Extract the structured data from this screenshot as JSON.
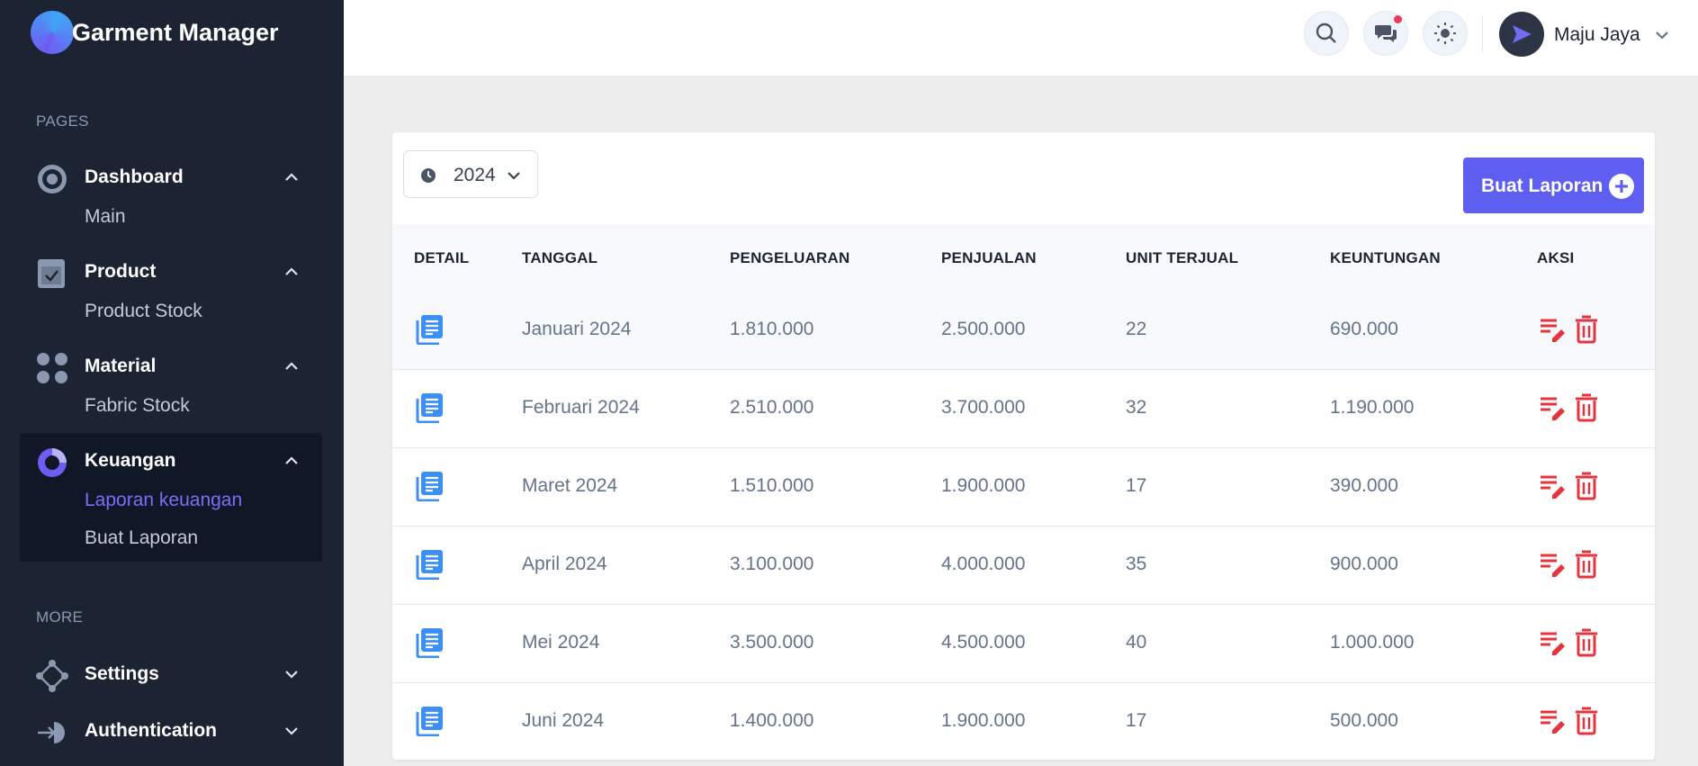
{
  "app": {
    "name": "Garment Manager"
  },
  "sidebar": {
    "group_pages": "PAGES",
    "group_more": "MORE",
    "dashboard": {
      "label": "Dashboard",
      "sub": [
        "Main"
      ]
    },
    "product": {
      "label": "Product",
      "sub": [
        "Product Stock"
      ]
    },
    "material": {
      "label": "Material",
      "sub": [
        "Fabric Stock"
      ]
    },
    "keuangan": {
      "label": "Keuangan",
      "sub": [
        "Laporan keuangan",
        "Buat Laporan"
      ],
      "active_sub": "Laporan keuangan"
    },
    "settings": {
      "label": "Settings"
    },
    "authentication": {
      "label": "Authentication"
    }
  },
  "header": {
    "user_name": "Maju Jaya",
    "icons": [
      "search-icon",
      "chat-icon",
      "sun-icon"
    ]
  },
  "toolbar": {
    "year": "2024",
    "create_label": "Buat Laporan"
  },
  "table": {
    "columns": [
      "DETAIL",
      "TANGGAL",
      "PENGELUARAN",
      "PENJUALAN",
      "UNIT TERJUAL",
      "KEUNTUNGAN",
      "AKSI"
    ],
    "rows": [
      {
        "tanggal": "Januari 2024",
        "pengeluaran": "1.810.000",
        "penjualan": "2.500.000",
        "unit": "22",
        "keuntungan": "690.000"
      },
      {
        "tanggal": "Februari 2024",
        "pengeluaran": "2.510.000",
        "penjualan": "3.700.000",
        "unit": "32",
        "keuntungan": "1.190.000"
      },
      {
        "tanggal": "Maret 2024",
        "pengeluaran": "1.510.000",
        "penjualan": "1.900.000",
        "unit": "17",
        "keuntungan": "390.000"
      },
      {
        "tanggal": "April 2024",
        "pengeluaran": "3.100.000",
        "penjualan": "4.000.000",
        "unit": "35",
        "keuntungan": "900.000"
      },
      {
        "tanggal": "Mei 2024",
        "pengeluaran": "3.500.000",
        "penjualan": "4.500.000",
        "unit": "40",
        "keuntungan": "1.000.000"
      },
      {
        "tanggal": "Juni 2024",
        "pengeluaran": "1.400.000",
        "penjualan": "1.900.000",
        "unit": "17",
        "keuntungan": "500.000"
      }
    ]
  },
  "colors": {
    "sidebar_bg": "#1c2434",
    "accent": "#5e5ef0",
    "detail_icon": "#3c8ff5",
    "action_icon": "#e5343d"
  }
}
